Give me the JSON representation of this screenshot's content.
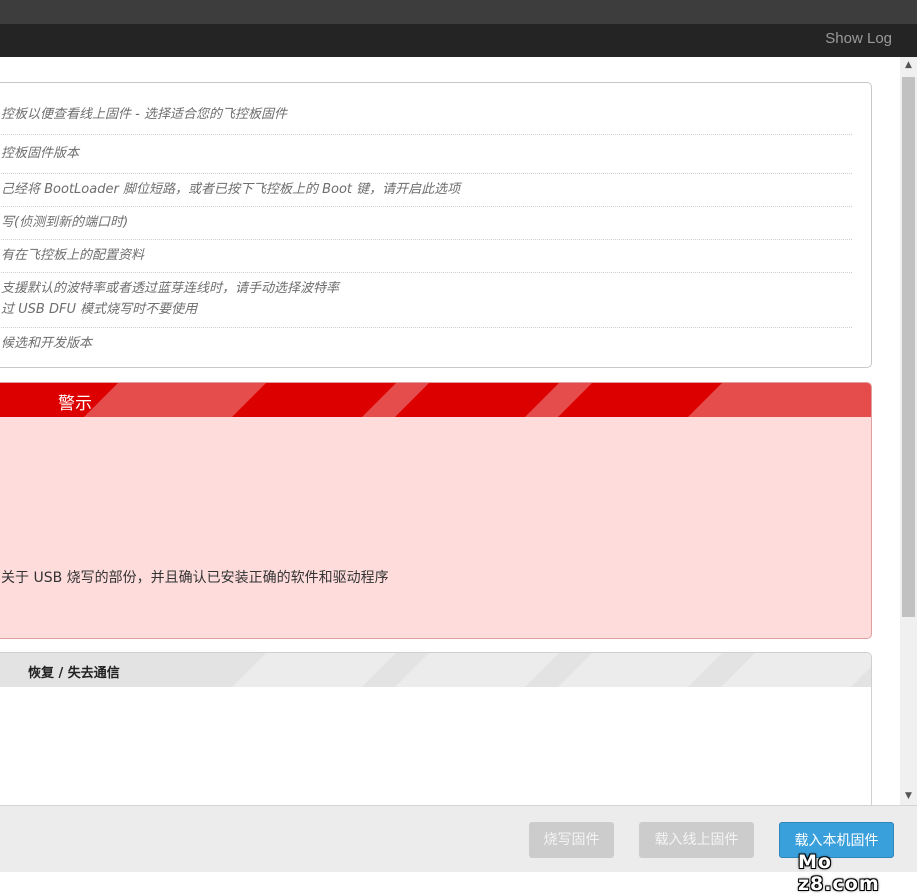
{
  "header": {
    "show_log": "Show Log"
  },
  "options": [
    {
      "lines": [
        "控板以便查看线上固件 - 选择适合您的飞控板固件"
      ]
    },
    {
      "lines": [
        "控板固件版本"
      ]
    },
    {
      "lines": [
        "己经将 BootLoader 脚位短路，或者已按下飞控板上的 Boot 键，请开启此选项"
      ]
    },
    {
      "lines": [
        "写(侦测到新的端口时)"
      ]
    },
    {
      "lines": [
        "有在飞控板上的配置资料"
      ]
    },
    {
      "lines": [
        "支援默认的波特率或者透过蓝芽连线时，请手动选择波特率",
        "过 USB DFU 模式烧写时不要使用"
      ]
    },
    {
      "lines": [
        "候选和开发版本"
      ]
    }
  ],
  "warning": {
    "title": "警示",
    "text": "关于 USB 烧写的部份，并且确认已安装正确的软件和驱动程序",
    "colors": {
      "header": "#e54d4d",
      "stripe": "#dd0000",
      "body": "#ffdcdc"
    }
  },
  "recovery": {
    "title": "恢复 / 失去通信"
  },
  "buttons": {
    "flash": "烧写固件",
    "load_online": "载入线上固件",
    "load_local": "载入本机固件"
  },
  "accent_color": "#3aa0dc",
  "watermark": "Mo z8.com"
}
